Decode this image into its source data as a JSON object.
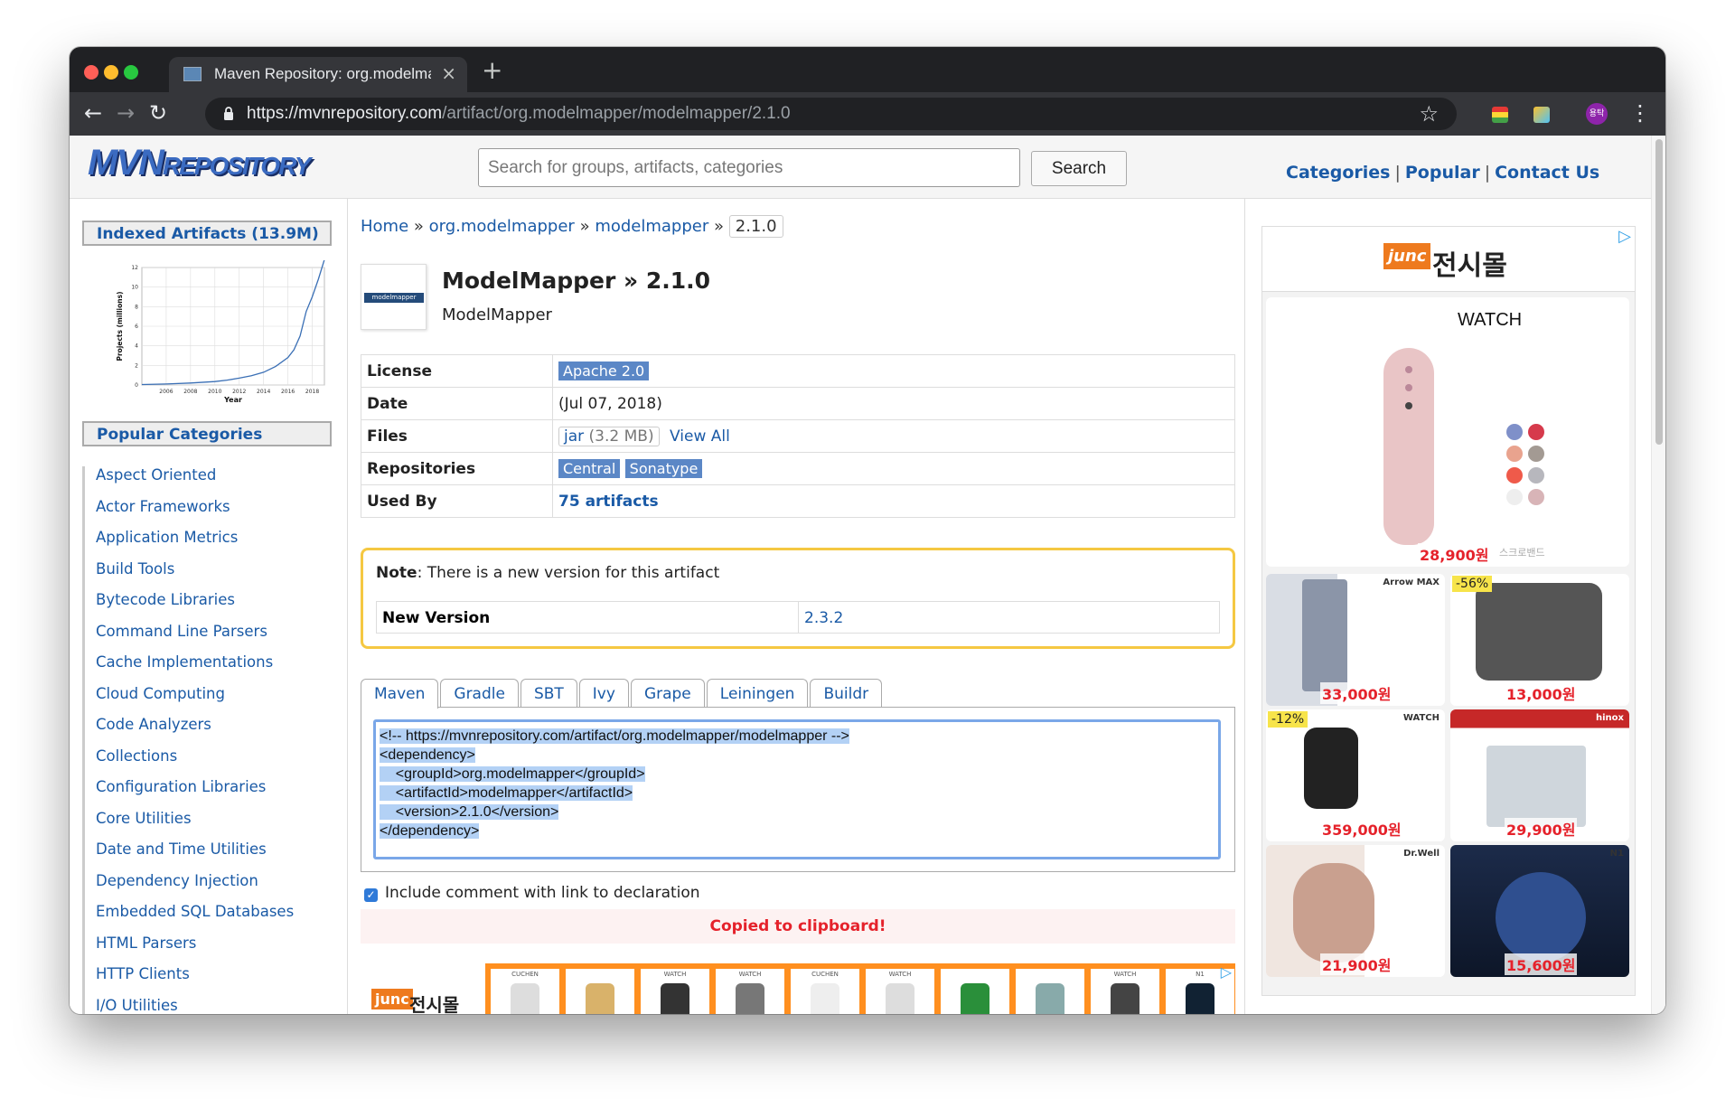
{
  "browser": {
    "tab_title": "Maven Repository: org.modelmapper",
    "url_domain": "https://mvnrepository.com",
    "url_path": "/artifact/org.modelmapper/modelmapper/2.1.0",
    "avatar_text": "용탁"
  },
  "site": {
    "logo_main": "MVN",
    "logo_sub": "REPOSITORY",
    "search_placeholder": "Search for groups, artifacts, categories",
    "search_button": "Search",
    "nav": [
      "Categories",
      "Popular",
      "Contact Us"
    ],
    "nav_separator": "|"
  },
  "sidebar": {
    "indexed_title": "Indexed Artifacts (13.9M)",
    "popular_title": "Popular Categories",
    "categories": [
      "Aspect Oriented",
      "Actor Frameworks",
      "Application Metrics",
      "Build Tools",
      "Bytecode Libraries",
      "Command Line Parsers",
      "Cache Implementations",
      "Cloud Computing",
      "Code Analyzers",
      "Collections",
      "Configuration Libraries",
      "Core Utilities",
      "Date and Time Utilities",
      "Dependency Injection",
      "Embedded SQL Databases",
      "HTML Parsers",
      "HTTP Clients",
      "I/O Utilities"
    ]
  },
  "chart_data": {
    "type": "line",
    "title": "",
    "xlabel": "Year",
    "ylabel": "Projects (millions)",
    "x_ticks": [
      "2006",
      "2008",
      "2010",
      "2012",
      "2014",
      "2016",
      "2018"
    ],
    "y_ticks": [
      "0",
      "2",
      "4",
      "6",
      "8",
      "10",
      "12"
    ],
    "xlim": [
      2004,
      2019
    ],
    "ylim": [
      0,
      12
    ],
    "grid": true,
    "series": [
      {
        "x": [
          2004,
          2006,
          2008,
          2010,
          2011,
          2012,
          2013,
          2014,
          2015,
          2016,
          2016.5,
          2017,
          2017.5,
          2018,
          2018.5,
          2019
        ],
        "y": [
          0.05,
          0.1,
          0.2,
          0.35,
          0.5,
          0.7,
          0.95,
          1.3,
          1.9,
          2.8,
          3.6,
          5.0,
          7.5,
          9.0,
          10.8,
          12.8
        ]
      }
    ]
  },
  "breadcrumb": {
    "items": [
      "Home",
      "org.modelmapper",
      "modelmapper"
    ],
    "separator": "»",
    "current": "2.1.0"
  },
  "artifact": {
    "icon_text": "modelmapper",
    "title": "ModelMapper » 2.1.0",
    "subtitle": "ModelMapper",
    "labels": {
      "license": "License",
      "date": "Date",
      "files": "Files",
      "repositories": "Repositories",
      "used_by": "Used By"
    },
    "license": "Apache 2.0",
    "date": "(Jul 07, 2018)",
    "jar_label": "jar",
    "jar_size": "(3.2 MB)",
    "view_all": "View All",
    "repositories": [
      "Central",
      "Sonatype"
    ],
    "used_by": "75 artifacts"
  },
  "note": {
    "label": "Note",
    "text": ": There is a new version for this artifact",
    "new_version_label": "New Version",
    "new_version": "2.3.2"
  },
  "dependency": {
    "tabs": [
      "Maven",
      "Gradle",
      "SBT",
      "Ivy",
      "Grape",
      "Leiningen",
      "Buildr"
    ],
    "active_tab": "Maven",
    "code_lines": [
      "<!-- https://mvnrepository.com/artifact/org.modelmapper/modelmapper -->",
      "<dependency>",
      "    <groupId>org.modelmapper</groupId>",
      "    <artifactId>modelmapper</artifactId>",
      "    <version>2.1.0</version>",
      "</dependency>"
    ],
    "include_comment_label": "Include comment with link to declaration",
    "include_comment_checked": true,
    "copied_message": "Copied to clipboard!"
  },
  "banner_ad": {
    "logo": "junc",
    "name": "전시몰",
    "thumb_labels": [
      "CUCHEN",
      "",
      "WATCH",
      "WATCH",
      "CUCHEN",
      "WATCH",
      "",
      "",
      "WATCH",
      "N1"
    ]
  },
  "side_ad": {
    "logo": "junc",
    "name": "전시몰",
    "hero_brand": "WATCH",
    "hero_price": "28,900원",
    "hero_tag": "스크로밴드",
    "items": [
      {
        "price": "33,000원",
        "discount": "",
        "label": "Arrow MAX"
      },
      {
        "price": "13,000원",
        "discount": "-56%",
        "label": ""
      },
      {
        "price": "359,000원",
        "discount": "-12%",
        "label": "WATCH"
      },
      {
        "price": "29,900원",
        "discount": "",
        "label": "hinox"
      },
      {
        "price": "21,900원",
        "discount": "",
        "label": "Dr.Well"
      },
      {
        "price": "15,600원",
        "discount": "",
        "label": "N1"
      }
    ]
  },
  "colors": {
    "link": "#1a5aa6",
    "tag": "#5b87c6",
    "note_border": "#f5c842",
    "copied": "#e5222b",
    "ad_orange": "#ee7a1e",
    "chrome_dark": "#202124"
  }
}
